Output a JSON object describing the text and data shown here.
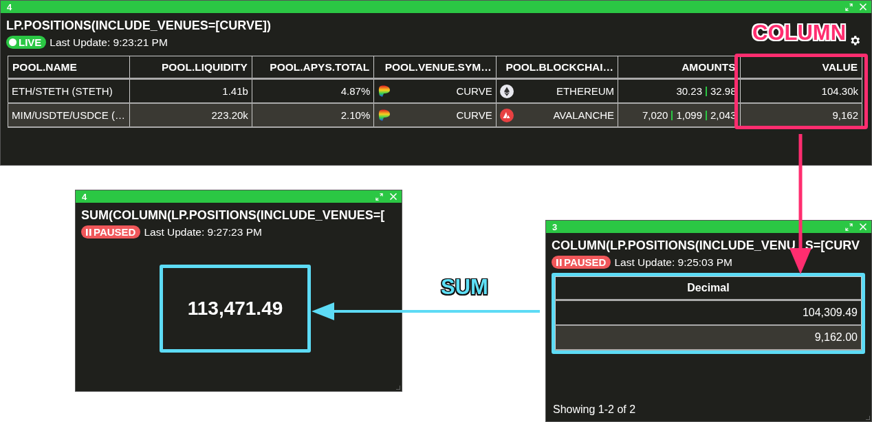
{
  "windows": [
    {
      "number": "4",
      "title": "LP.POSITIONS(INCLUDE_VENUES=[CURVE])",
      "paused": false,
      "state_label": "LIVE",
      "last_update": "Last Update: 9:23:21 PM",
      "settings": true,
      "content": {
        "kind": "table",
        "columns": [
          "POOL.NAME",
          "POOL.LIQUIDITY",
          "POOL.APYS.TOTAL",
          "POOL.VENUE.SYM…",
          "POOL.BLOCKCHAI…",
          "AMOUNTS",
          "VALUE"
        ],
        "rows": [
          {
            "cells": [
              {
                "kind": "text",
                "text": "ETH/STETH (STETH)"
              },
              {
                "kind": "text",
                "text": "1.41b"
              },
              {
                "kind": "text",
                "text": "4.87%"
              },
              {
                "kind": "venue",
                "text": "CURVE"
              },
              {
                "kind": "ethereum",
                "text": "ETHEREUM"
              },
              {
                "kind": "amounts",
                "values": [
                  "30.23",
                  "32.98"
                ]
              },
              {
                "kind": "text",
                "text": "104.30k"
              }
            ]
          },
          {
            "cells": [
              {
                "kind": "text",
                "text": "MIM/USDTE/USDCE (…"
              },
              {
                "kind": "text",
                "text": "223.20k"
              },
              {
                "kind": "text",
                "text": "2.10%"
              },
              {
                "kind": "venue",
                "text": "CURVE"
              },
              {
                "kind": "avalanche",
                "text": "AVALANCHE"
              },
              {
                "kind": "amounts",
                "values": [
                  "7,020",
                  "1,099",
                  "2,043"
                ]
              },
              {
                "kind": "text",
                "text": "9,162"
              }
            ]
          }
        ]
      }
    },
    {
      "number": "4",
      "title": "SUM(COLUMN(LP.POSITIONS(INCLUDE_VENUES=[",
      "paused": true,
      "state_label": "PAUSED",
      "last_update": "Last Update: 9:27:23 PM",
      "settings": false,
      "content": {
        "kind": "value",
        "value": "113,471.49"
      }
    },
    {
      "number": "3",
      "title_parts": [
        "COLUMN(LP.POSITIONS(INCLUDE_VENU",
        "S=[CURV"
      ],
      "paused": true,
      "state_label": "PAUSED",
      "last_update": "Last Update: 9:25:03 PM",
      "settings": false,
      "content": {
        "kind": "list",
        "columns": [
          "Decimal"
        ],
        "rows": [
          {
            "cells": [
              {
                "kind": "text",
                "text": "104,309.49"
              }
            ]
          },
          {
            "cells": [
              {
                "kind": "text",
                "text": "9,162.00"
              }
            ]
          }
        ],
        "footer": "Showing 1-2 of 2"
      }
    }
  ],
  "annotations": [
    {
      "kind": "column",
      "label": "COLUMN"
    },
    {
      "kind": "sum",
      "label": "SUM"
    }
  ]
}
